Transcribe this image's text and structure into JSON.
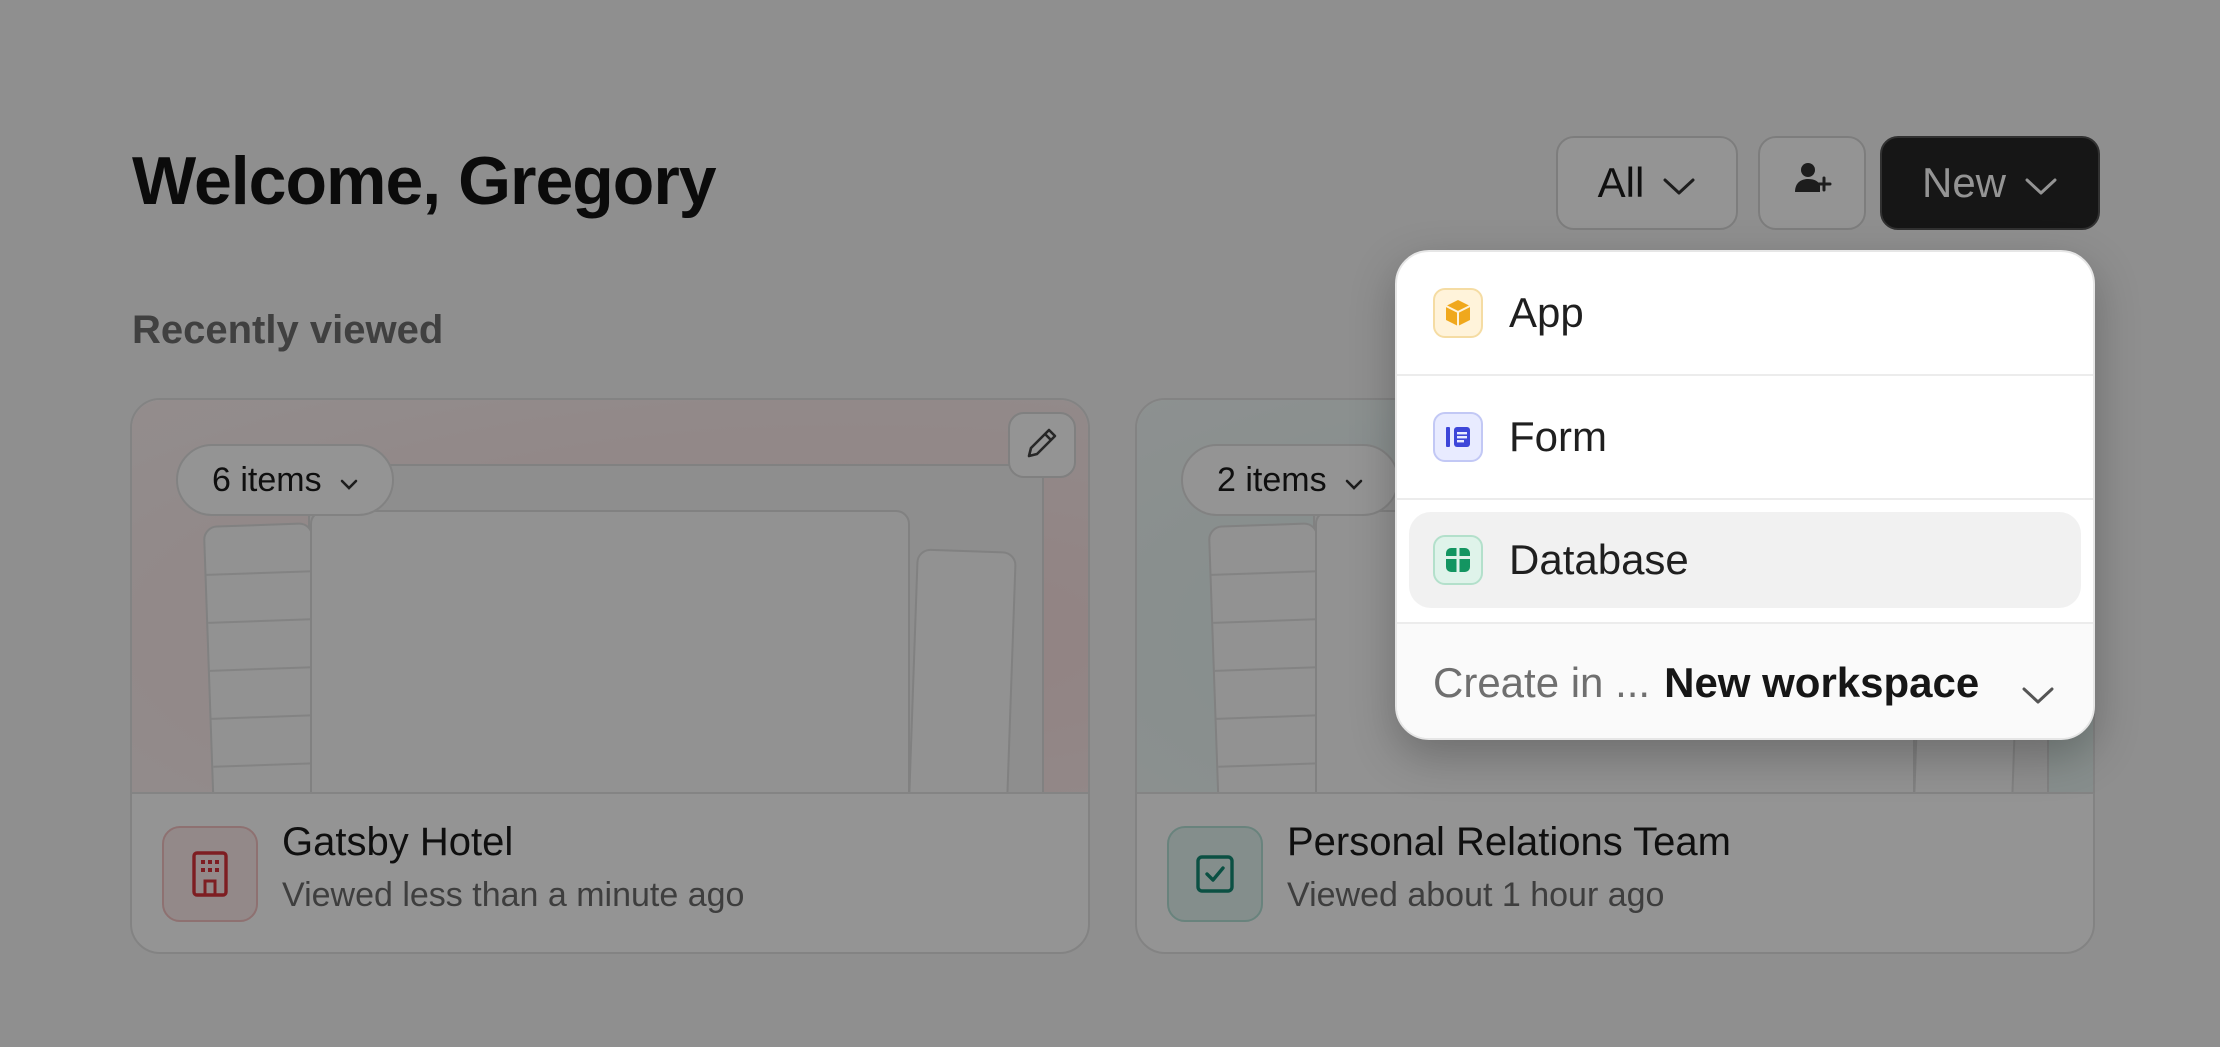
{
  "header": {
    "title": "Welcome, Gregory",
    "filter_label": "All",
    "new_label": "New"
  },
  "section": {
    "title": "Recently viewed"
  },
  "cards": [
    {
      "items_label": "6 items",
      "name": "Gatsby Hotel",
      "viewed": "Viewed less than a minute ago",
      "icon": "building-icon",
      "accent": "#d9343c"
    },
    {
      "items_label": "2 items",
      "name": "Personal Relations Team",
      "viewed": "Viewed about 1 hour ago",
      "icon": "checkbox-icon",
      "accent": "#138a74"
    }
  ],
  "new_menu": {
    "items": [
      {
        "label": "App",
        "icon": "cube-icon",
        "color": "#f0a81c"
      },
      {
        "label": "Form",
        "icon": "form-icon",
        "color": "#3d46d9"
      },
      {
        "label": "Database",
        "icon": "table-icon",
        "color": "#139561"
      }
    ],
    "footer_prefix": "Create in ...",
    "footer_target": "New workspace"
  }
}
